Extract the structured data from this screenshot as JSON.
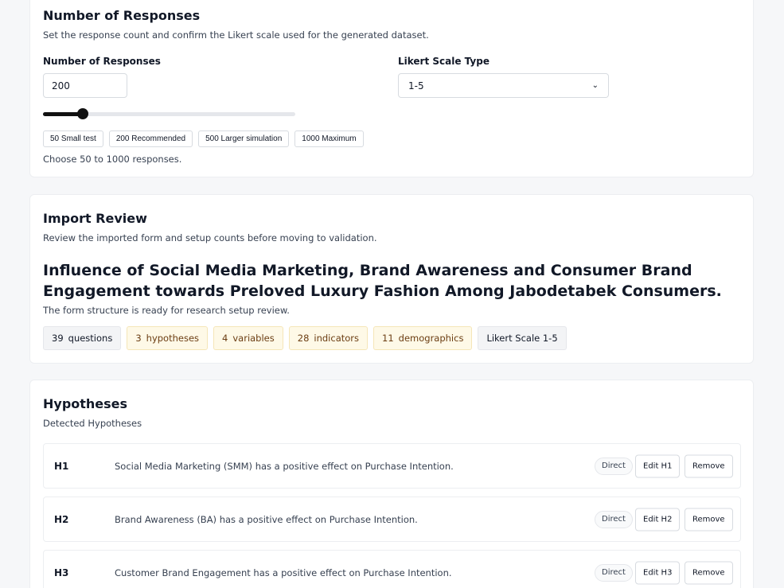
{
  "responses": {
    "title": "Number of Responses",
    "description": "Set the response count and confirm the Likert scale used for the generated dataset.",
    "count_label": "Number of Responses",
    "count_value": "200",
    "scale_label": "Likert Scale Type",
    "scale_value": "1-5",
    "slider": {
      "min": 50,
      "max": 1000,
      "value": 200
    },
    "presets": [
      "50 Small test",
      "200 Recommended",
      "500 Larger simulation",
      "1000 Maximum"
    ],
    "hint": "Choose 50 to 1000 responses."
  },
  "import_review": {
    "title": "Import Review",
    "description": "Review the imported form and setup counts before moving to validation.",
    "form_title": "Influence of Social Media Marketing, Brand Awareness and Consumer Brand Engagement towards Preloved Luxury Fashion Among Jabodetabek Consumers.",
    "status": "The form structure is ready for research setup review.",
    "chips": [
      {
        "count": "39",
        "label": "questions"
      },
      {
        "count": "3",
        "label": "hypotheses"
      },
      {
        "count": "4",
        "label": "variables"
      },
      {
        "count": "28",
        "label": "indicators"
      },
      {
        "count": "11",
        "label": "demographics"
      },
      {
        "label": "Likert Scale 1-5"
      }
    ]
  },
  "hypotheses": {
    "title": "Hypotheses",
    "subtitle": "Detected Hypotheses",
    "remove_label": "Remove",
    "items": [
      {
        "id": "H1",
        "text": "Social Media Marketing (SMM) has a positive effect on Purchase Intention.",
        "type": "Direct",
        "edit_label": "Edit H1"
      },
      {
        "id": "H2",
        "text": "Brand Awareness (BA) has a positive effect on Purchase Intention.",
        "type": "Direct",
        "edit_label": "Edit H2"
      },
      {
        "id": "H3",
        "text": "Customer Brand Engagement has a positive effect on Purchase Intention.",
        "type": "Direct",
        "edit_label": "Edit H3"
      }
    ]
  }
}
